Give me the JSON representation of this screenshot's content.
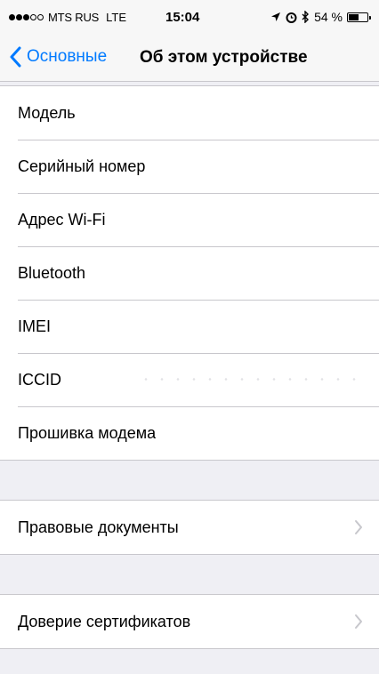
{
  "status_bar": {
    "signal_dots_filled": 3,
    "signal_dots_total": 5,
    "carrier": "MTS RUS",
    "network": "LTE",
    "time": "15:04",
    "location_icon": "location-arrow-icon",
    "alarm_icon": "alarm-icon",
    "bluetooth_icon": "bluetooth-icon",
    "battery_percent": "54 %",
    "battery_level": 0.54
  },
  "nav": {
    "back_label": "Основные",
    "title": "Об этом устройстве"
  },
  "info_group": {
    "rows": [
      {
        "label": "Модель",
        "value": ""
      },
      {
        "label": "Серийный номер",
        "value": ""
      },
      {
        "label": "Адрес Wi-Fi",
        "value": ""
      },
      {
        "label": "Bluetooth",
        "value": ""
      },
      {
        "label": "IMEI",
        "value": ""
      },
      {
        "label": "ICCID",
        "value": ""
      },
      {
        "label": "Прошивка модема",
        "value": ""
      }
    ]
  },
  "legal_group": {
    "label": "Правовые документы"
  },
  "trust_group": {
    "label": "Доверие сертификатов"
  },
  "colors": {
    "accent": "#007aff",
    "background": "#efeff4",
    "separator": "#c8c7cc",
    "chevron": "#c7c7cc"
  }
}
